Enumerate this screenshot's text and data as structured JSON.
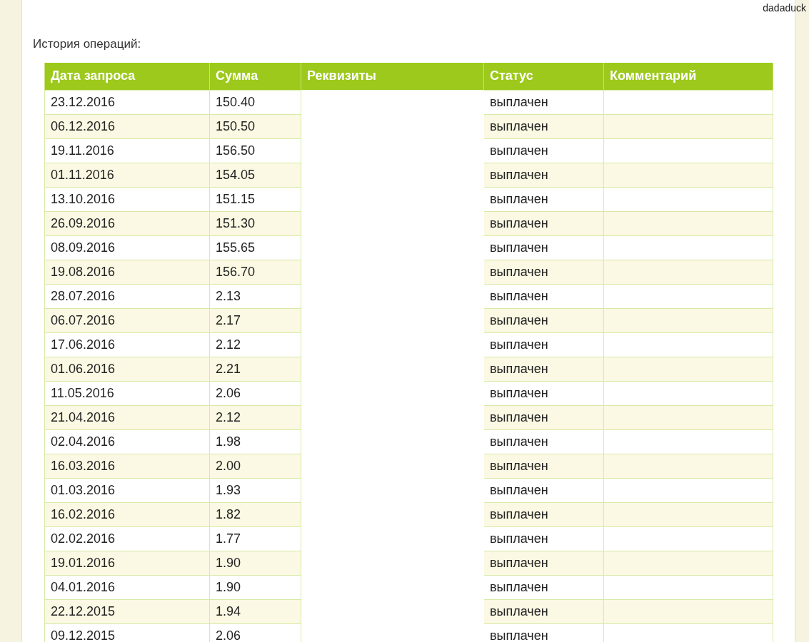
{
  "user": "dadaduck",
  "title": "История операций:",
  "table": {
    "columns": [
      "Дата запроса",
      "Сумма",
      "Реквизиты",
      "Статус",
      "Комментарий"
    ],
    "rows": [
      {
        "date": "23.12.2016",
        "amount": "150.40",
        "status": "выплачен"
      },
      {
        "date": "06.12.2016",
        "amount": "150.50",
        "status": "выплачен"
      },
      {
        "date": "19.11.2016",
        "amount": "156.50",
        "status": "выплачен"
      },
      {
        "date": "01.11.2016",
        "amount": "154.05",
        "status": "выплачен"
      },
      {
        "date": "13.10.2016",
        "amount": "151.15",
        "status": "выплачен"
      },
      {
        "date": "26.09.2016",
        "amount": "151.30",
        "status": "выплачен"
      },
      {
        "date": "08.09.2016",
        "amount": "155.65",
        "status": "выплачен"
      },
      {
        "date": "19.08.2016",
        "amount": "156.70",
        "status": "выплачен"
      },
      {
        "date": "28.07.2016",
        "amount": "2.13",
        "status": "выплачен"
      },
      {
        "date": "06.07.2016",
        "amount": "2.17",
        "status": "выплачен"
      },
      {
        "date": "17.06.2016",
        "amount": "2.12",
        "status": "выплачен"
      },
      {
        "date": "01.06.2016",
        "amount": "2.21",
        "status": "выплачен"
      },
      {
        "date": "11.05.2016",
        "amount": "2.06",
        "status": "выплачен"
      },
      {
        "date": "21.04.2016",
        "amount": "2.12",
        "status": "выплачен"
      },
      {
        "date": "02.04.2016",
        "amount": "1.98",
        "status": "выплачен"
      },
      {
        "date": "16.03.2016",
        "amount": "2.00",
        "status": "выплачен"
      },
      {
        "date": "01.03.2016",
        "amount": "1.93",
        "status": "выплачен"
      },
      {
        "date": "16.02.2016",
        "amount": "1.82",
        "status": "выплачен"
      },
      {
        "date": "02.02.2016",
        "amount": "1.77",
        "status": "выплачен"
      },
      {
        "date": "19.01.2016",
        "amount": "1.90",
        "status": "выплачен"
      },
      {
        "date": "04.01.2016",
        "amount": "1.90",
        "status": "выплачен"
      },
      {
        "date": "22.12.2015",
        "amount": "1.94",
        "status": "выплачен"
      },
      {
        "date": "09.12.2015",
        "amount": "2.06",
        "status": "выплачен"
      }
    ]
  }
}
